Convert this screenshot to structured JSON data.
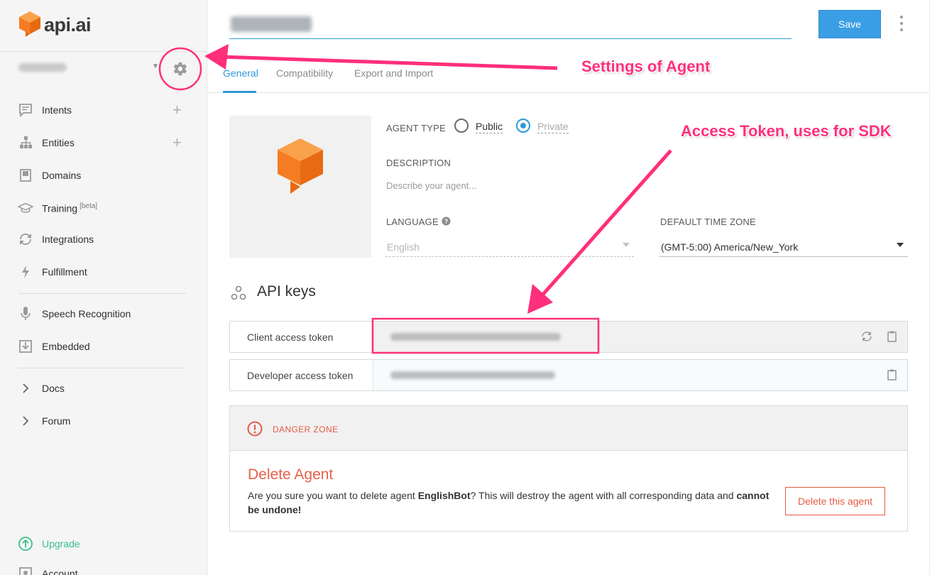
{
  "brand": {
    "logo_text": "api.ai",
    "logo_color": "#f57c22"
  },
  "sidebar": {
    "items": [
      {
        "label": "Intents",
        "icon": "chat-bubble-icon",
        "has_add": true
      },
      {
        "label": "Entities",
        "icon": "hierarchy-icon",
        "has_add": true
      },
      {
        "label": "Domains",
        "icon": "book-icon",
        "has_add": false
      },
      {
        "label": "Training",
        "sup": "[beta]",
        "icon": "graduation-cap-icon",
        "has_add": false
      },
      {
        "label": "Integrations",
        "icon": "sync-icon",
        "has_add": false
      },
      {
        "label": "Fulfillment",
        "icon": "lightning-icon",
        "has_add": false
      },
      {
        "label": "Speech Recognition",
        "icon": "microphone-icon",
        "has_add": false
      },
      {
        "label": "Embedded",
        "icon": "download-box-icon",
        "has_add": false
      },
      {
        "label": "Docs",
        "icon": "chevron-right-icon",
        "has_add": false
      },
      {
        "label": "Forum",
        "icon": "chevron-right-icon",
        "has_add": false
      }
    ],
    "upgrade_label": "Upgrade",
    "account_label": "Account",
    "upgrade_color": "#3cbf8c"
  },
  "header": {
    "save_label": "Save"
  },
  "tabs": [
    "General",
    "Compatibility",
    "Export and Import"
  ],
  "form": {
    "agent_type_label": "AGENT TYPE",
    "public_label": "Public",
    "private_label": "Private",
    "selected_type": "Private",
    "description_label": "DESCRIPTION",
    "description_placeholder": "Describe your agent...",
    "language_label": "LANGUAGE",
    "language_value": "English",
    "timezone_label": "DEFAULT TIME ZONE",
    "timezone_value": "(GMT-5:00) America/New_York"
  },
  "api_keys": {
    "title": "API keys",
    "client_label": "Client access token",
    "developer_label": "Developer access token"
  },
  "danger_zone": {
    "header": "DANGER ZONE",
    "title": "Delete Agent",
    "text_pre": "Are you sure you want to delete agent ",
    "agent_name": "EnglishBot",
    "text_mid": "? This will destroy the agent with all corresponding data and ",
    "text_bold": "cannot be undone!",
    "button_label": "Delete this agent",
    "color": "#e55a42"
  },
  "annotations": {
    "settings_text": "Settings of Agent",
    "token_text": "Access Token, uses for SDK",
    "color": "#ff2f7b"
  },
  "accent_color": "#2d9ad8"
}
